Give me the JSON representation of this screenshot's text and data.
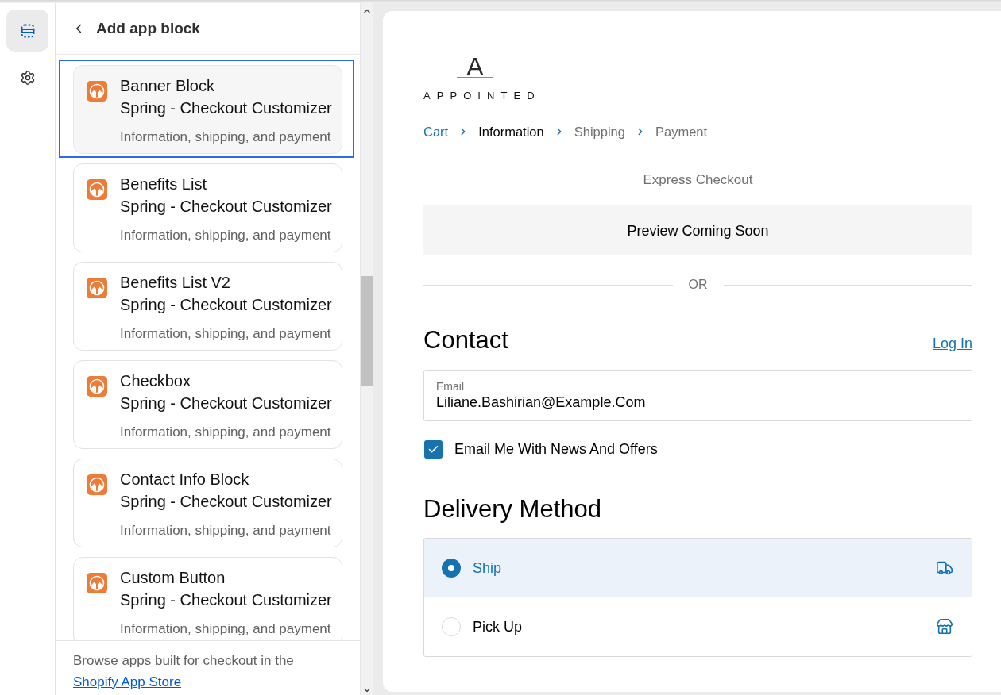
{
  "rail": {
    "items": [
      {
        "kind": "sections",
        "selected": true
      },
      {
        "kind": "settings",
        "selected": false
      }
    ]
  },
  "panel": {
    "title": "Add app block",
    "blocks": [
      {
        "name": "Banner Block",
        "app": "Spring - Checkout Customizer",
        "targets": "Information, shipping, and payment",
        "selected": true
      },
      {
        "name": "Benefits List",
        "app": "Spring - Checkout Customizer",
        "targets": "Information, shipping, and payment",
        "selected": false
      },
      {
        "name": "Benefits List V2",
        "app": "Spring - Checkout Customizer",
        "targets": "Information, shipping, and payment",
        "selected": false
      },
      {
        "name": "Checkbox",
        "app": "Spring - Checkout Customizer",
        "targets": "Information, shipping, and payment",
        "selected": false
      },
      {
        "name": "Contact Info Block",
        "app": "Spring - Checkout Customizer",
        "targets": "Information, shipping, and payment",
        "selected": false
      },
      {
        "name": "Custom Button",
        "app": "Spring - Checkout Customizer",
        "targets": "Information, shipping, and payment",
        "selected": false
      }
    ],
    "footer": {
      "text": "Browse apps built for checkout in the",
      "link": "Shopify App Store"
    }
  },
  "preview": {
    "logo": {
      "mark": "A",
      "name": "APPOINTED"
    },
    "breadcrumbs": [
      {
        "label": "Cart",
        "kind": "link"
      },
      {
        "label": "Information",
        "kind": "current"
      },
      {
        "label": "Shipping",
        "kind": "upcoming"
      },
      {
        "label": "Payment",
        "kind": "upcoming"
      }
    ],
    "express_checkout": {
      "title": "Express Checkout",
      "notice": "Preview Coming Soon"
    },
    "divider": "OR",
    "contact": {
      "heading": "Contact",
      "login_link": "Log In",
      "email": {
        "label": "Email",
        "value": "Liliane.Bashirian@Example.Com"
      },
      "newsletter": {
        "label": "Email Me With News And Offers",
        "checked": true
      }
    },
    "delivery": {
      "heading": "Delivery Method",
      "options": [
        {
          "label": "Ship",
          "kind": "ship",
          "selected": true
        },
        {
          "label": "Pick Up",
          "kind": "pickup",
          "selected": false
        }
      ]
    }
  }
}
